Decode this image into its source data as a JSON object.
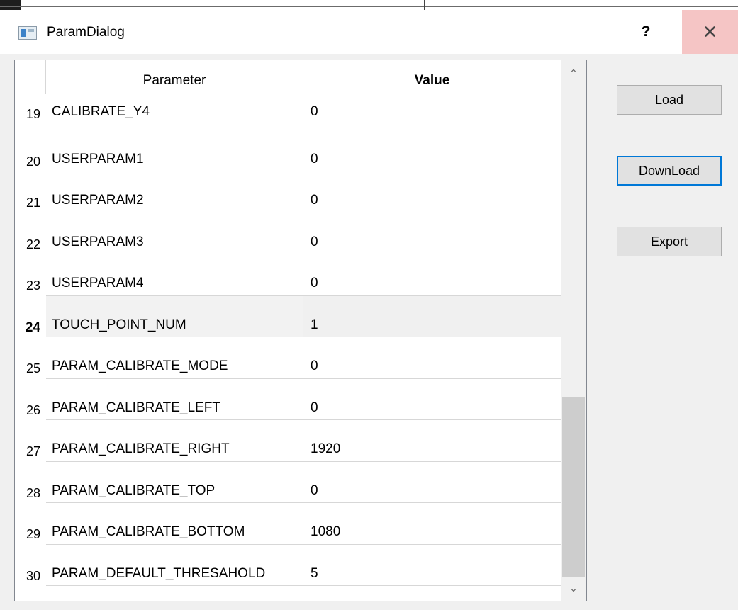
{
  "window": {
    "title": "ParamDialog",
    "help_label": "?",
    "close_label": "✕",
    "icon": "app-window-icon"
  },
  "table": {
    "columns": [
      "Parameter",
      "Value"
    ],
    "rows": [
      {
        "num": "19",
        "param": "CALIBRATE_Y4",
        "value": "0"
      },
      {
        "num": "20",
        "param": "USERPARAM1",
        "value": "0"
      },
      {
        "num": "21",
        "param": "USERPARAM2",
        "value": "0"
      },
      {
        "num": "22",
        "param": "USERPARAM3",
        "value": "0"
      },
      {
        "num": "23",
        "param": "USERPARAM4",
        "value": "0"
      },
      {
        "num": "24",
        "param": "TOUCH_POINT_NUM",
        "value": "1"
      },
      {
        "num": "25",
        "param": "PARAM_CALIBRATE_MODE",
        "value": "0"
      },
      {
        "num": "26",
        "param": "PARAM_CALIBRATE_LEFT",
        "value": "0"
      },
      {
        "num": "27",
        "param": "PARAM_CALIBRATE_RIGHT",
        "value": "1920"
      },
      {
        "num": "28",
        "param": "PARAM_CALIBRATE_TOP",
        "value": "0"
      },
      {
        "num": "29",
        "param": "PARAM_CALIBRATE_BOTTOM",
        "value": "1080"
      },
      {
        "num": "30",
        "param": "PARAM_DEFAULT_THRESAHOLD",
        "value": "5"
      }
    ],
    "current_row": "24",
    "scroll_up_icon": "chevron-up-icon",
    "scroll_down_icon": "chevron-down-icon"
  },
  "buttons": {
    "load": "Load",
    "download": "DownLoad",
    "export": "Export"
  },
  "colors": {
    "focus_border": "#0078d7",
    "close_hover_bg": "#f5c5c5"
  }
}
